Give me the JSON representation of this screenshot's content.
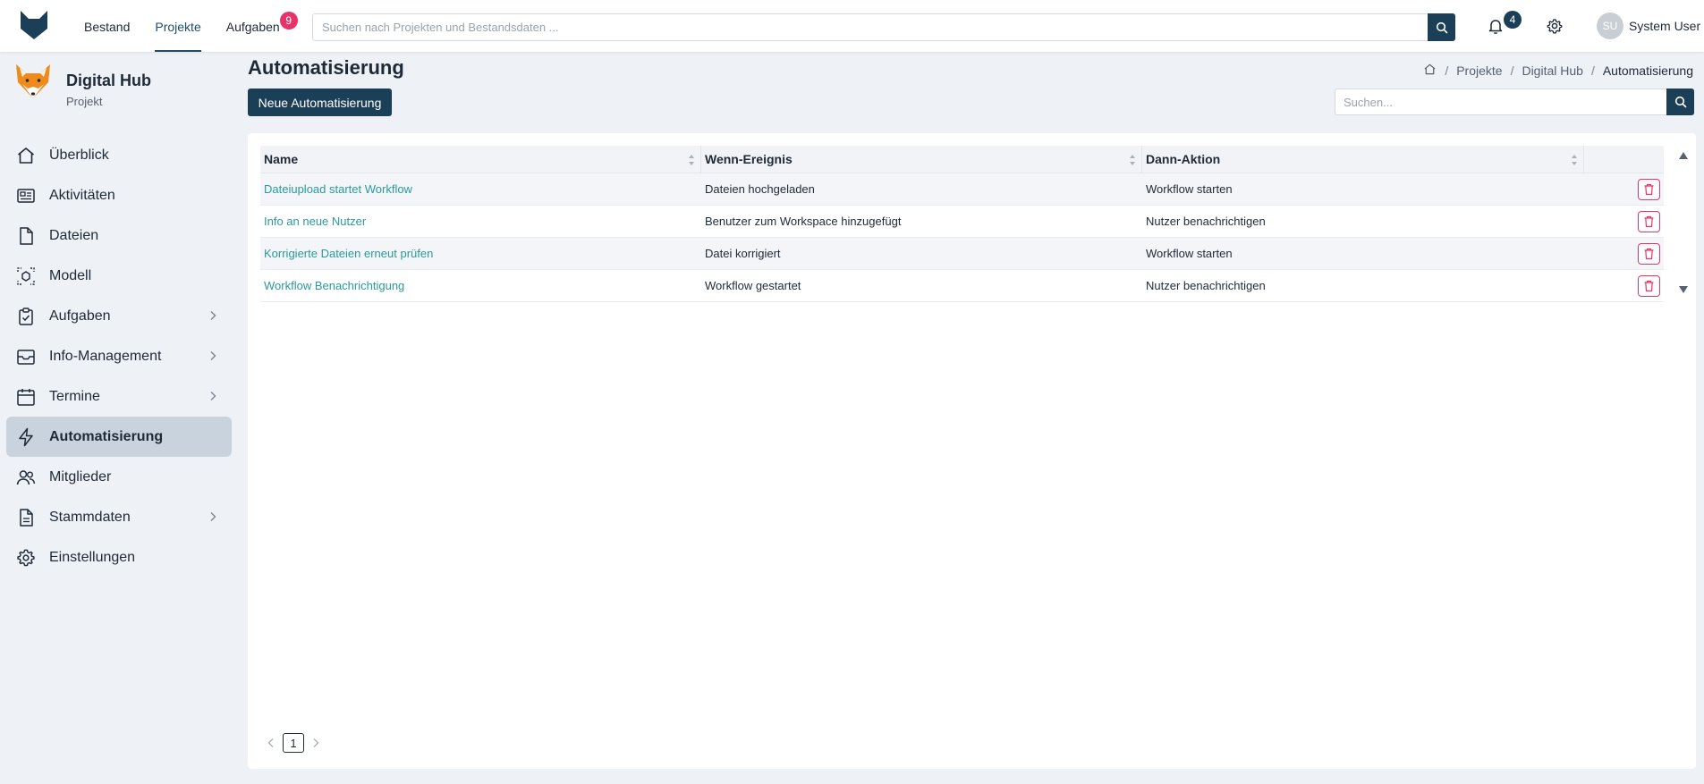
{
  "topbar": {
    "nav": [
      {
        "label": "Bestand"
      },
      {
        "label": "Projekte"
      },
      {
        "label": "Aufgaben",
        "badge": "9"
      }
    ],
    "search_placeholder": "Suchen nach Projekten und Bestandsdaten ...",
    "notification_count": "4",
    "user_initials": "SU",
    "user_name": "System User"
  },
  "project": {
    "title": "Digital Hub",
    "subtitle": "Projekt"
  },
  "sidebar": {
    "items": [
      {
        "label": "Überblick",
        "icon": "home-icon"
      },
      {
        "label": "Aktivitäten",
        "icon": "newspaper-icon"
      },
      {
        "label": "Dateien",
        "icon": "file-icon"
      },
      {
        "label": "Modell",
        "icon": "model-icon"
      },
      {
        "label": "Aufgaben",
        "icon": "clipboard-check-icon"
      },
      {
        "label": "Info-Management",
        "icon": "inbox-icon"
      },
      {
        "label": "Termine",
        "icon": "calendar-icon"
      },
      {
        "label": "Automatisierung",
        "icon": "lightning-icon"
      },
      {
        "label": "Mitglieder",
        "icon": "users-icon"
      },
      {
        "label": "Stammdaten",
        "icon": "document-icon"
      },
      {
        "label": "Einstellungen",
        "icon": "gear-icon"
      }
    ]
  },
  "main": {
    "title": "Automatisierung",
    "new_button": "Neue Automatisierung",
    "search_placeholder": "Suchen...",
    "breadcrumb": [
      "Projekte",
      "Digital Hub",
      "Automatisierung"
    ]
  },
  "table": {
    "headers": [
      "Name",
      "Wenn-Ereignis",
      "Dann-Aktion"
    ],
    "rows": [
      {
        "name": "Dateiupload startet Workflow",
        "event": "Dateien hochgeladen",
        "action": "Workflow starten"
      },
      {
        "name": "Info an neue Nutzer",
        "event": "Benutzer zum Workspace hinzugefügt",
        "action": "Nutzer benachrichtigen"
      },
      {
        "name": "Korrigierte Dateien erneut prüfen",
        "event": "Datei korrigiert",
        "action": "Workflow starten"
      },
      {
        "name": "Workflow Benachrichtigung",
        "event": "Workflow gestartet",
        "action": "Nutzer benachrichtigen"
      }
    ]
  },
  "pagination": {
    "current": "1"
  },
  "colors": {
    "primary": "#1c3f58",
    "link": "#2b9a99",
    "danger": "#e8336a",
    "background": "#eef1f5",
    "active_nav": "#c9d3dd"
  }
}
